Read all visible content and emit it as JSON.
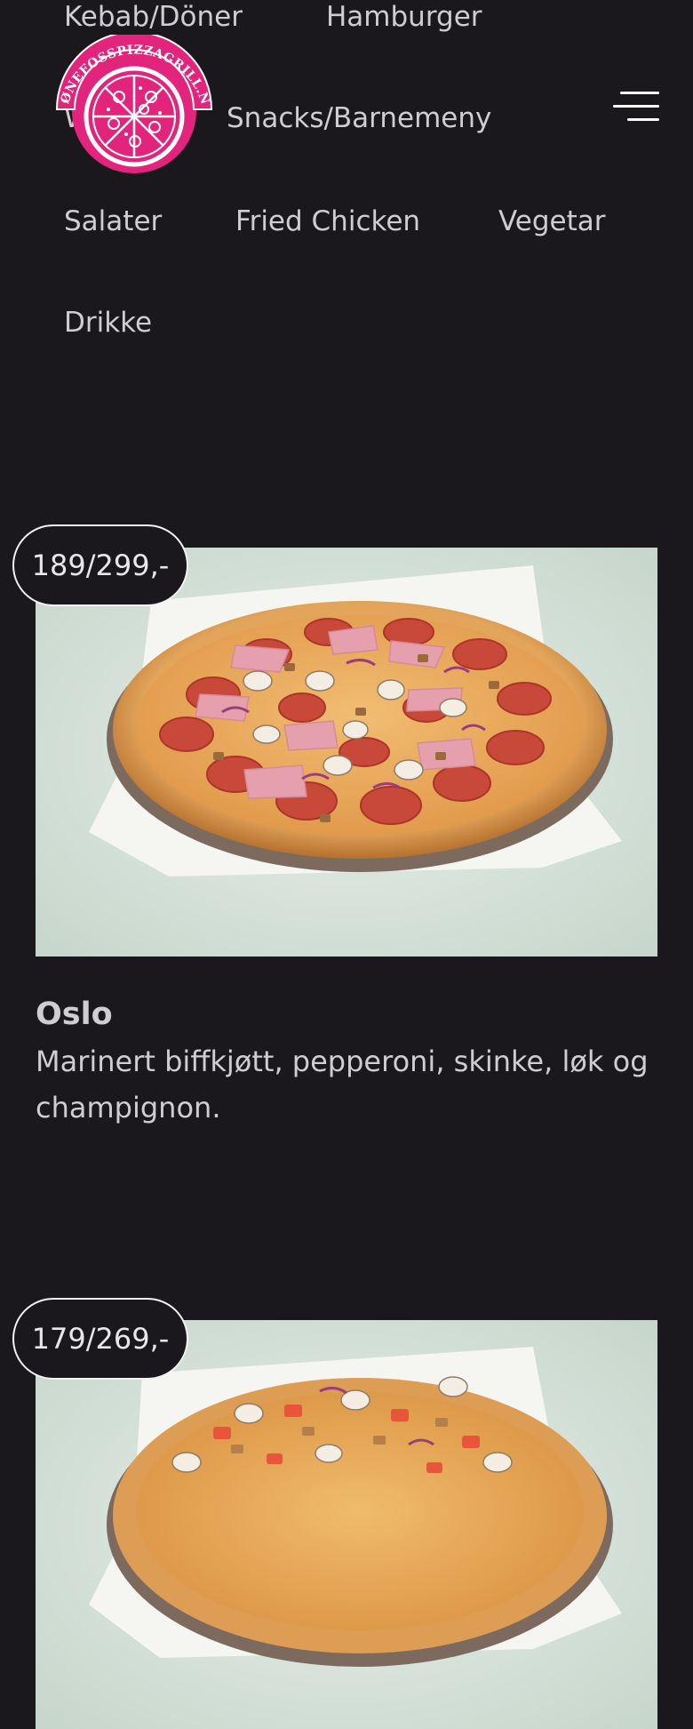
{
  "nav": {
    "categories": [
      {
        "label": "Kebab/Döner"
      },
      {
        "label": "Hamburger"
      },
      {
        "label": "W"
      },
      {
        "label": "Snacks/Barnemeny"
      },
      {
        "label": "Salater"
      },
      {
        "label": "Fried Chicken"
      },
      {
        "label": "Vegetar"
      },
      {
        "label": "Drikke"
      }
    ],
    "logo_text": "HØNEFOSSPIZZAGRILL.NO",
    "menu_icon": "hamburger-menu-icon"
  },
  "colors": {
    "background": "#1a171d",
    "text": "#cfcdd2",
    "brand_pink": "#e2247c",
    "badge_border": "#f3f1f5"
  },
  "items": [
    {
      "price": "189/299,-",
      "name": "Oslo",
      "description": "Marinert biffkjøtt, pepperoni, skinke, løk og champignon.",
      "image": "pizza-photo"
    },
    {
      "price": "179/269,-",
      "name": "",
      "description": "",
      "image": "pizza-photo"
    }
  ]
}
